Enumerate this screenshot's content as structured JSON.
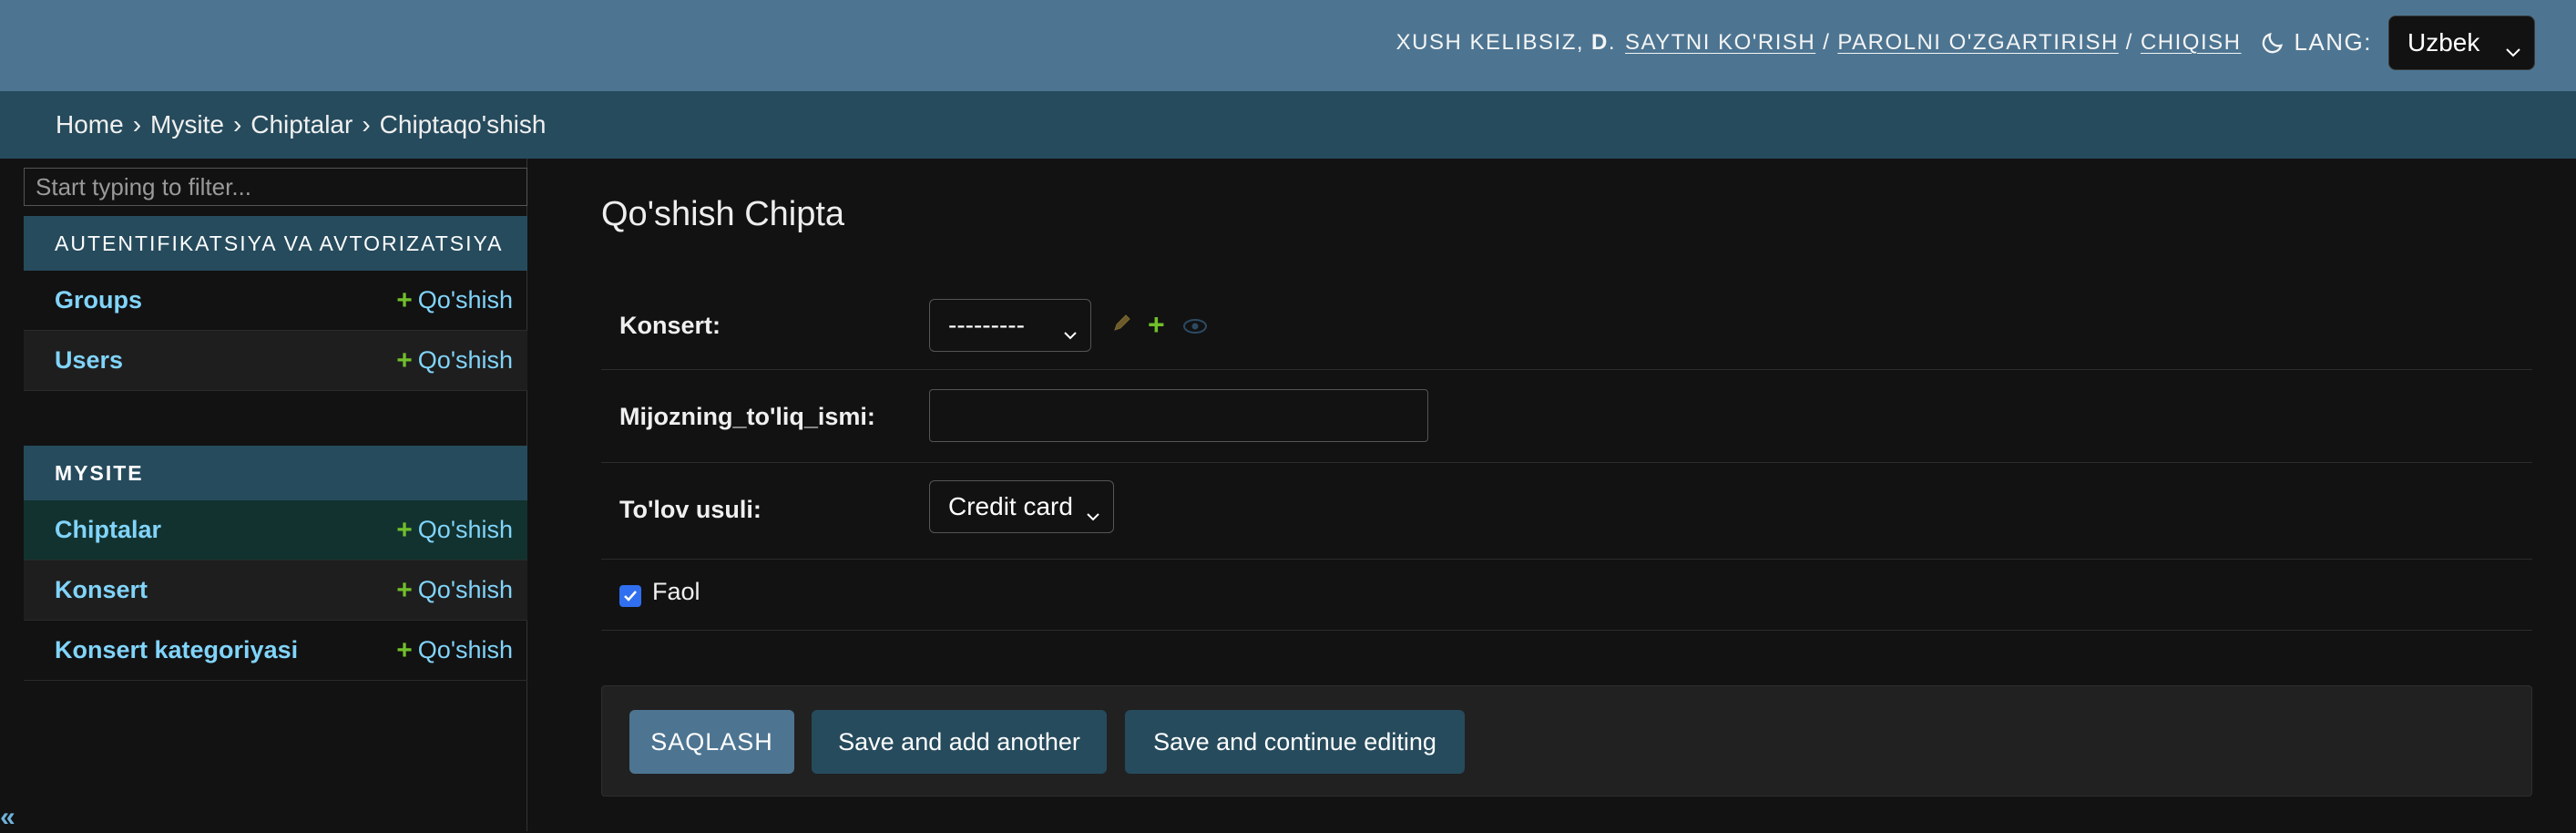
{
  "header": {
    "welcome": "XUSH KELIBSIZ,",
    "username": "D",
    "links": [
      "SAYTNI KO'RISH",
      "PAROLNI O'ZGARTIRISH",
      "CHIQISH"
    ],
    "lang_label": "LANG:",
    "lang_value": "Uzbek"
  },
  "breadcrumbs": [
    "Home",
    "Mysite",
    "Chiptalar",
    "Chiptaqo'shish"
  ],
  "sidebar": {
    "filter_placeholder": "Start typing to filter...",
    "apps": [
      {
        "caption": "AUTENTIFIKATSIYA VA AVTORIZATSIYA",
        "models": [
          {
            "name": "Groups",
            "add": "Qo'shish"
          },
          {
            "name": "Users",
            "add": "Qo'shish"
          }
        ]
      },
      {
        "caption": "MYSITE",
        "models": [
          {
            "name": "Chiptalar",
            "add": "Qo'shish"
          },
          {
            "name": "Konsert",
            "add": "Qo'shish"
          },
          {
            "name": "Konsert kategoriyasi",
            "add": "Qo'shish"
          }
        ]
      }
    ],
    "collapse_glyph": "«"
  },
  "form": {
    "title": "Qo'shish Chipta",
    "konsert_label": "Konsert:",
    "konsert_value": "---------",
    "mijoz_label": "Mijozning_to'liq_ismi:",
    "mijoz_value": "",
    "tolov_label": "To'lov usuli:",
    "tolov_value": "Credit card",
    "faol_label": "Faol",
    "faol_checked": true
  },
  "buttons": {
    "save": "SAQLASH",
    "save_add": "Save and add another",
    "save_continue": "Save and continue editing"
  },
  "colors": {
    "header_bg": "#4d7592",
    "breadcrumb_bg": "#264b5d",
    "link": "#81d4fa",
    "add_plus": "#70bf2b",
    "selected_row": "#12322f"
  }
}
